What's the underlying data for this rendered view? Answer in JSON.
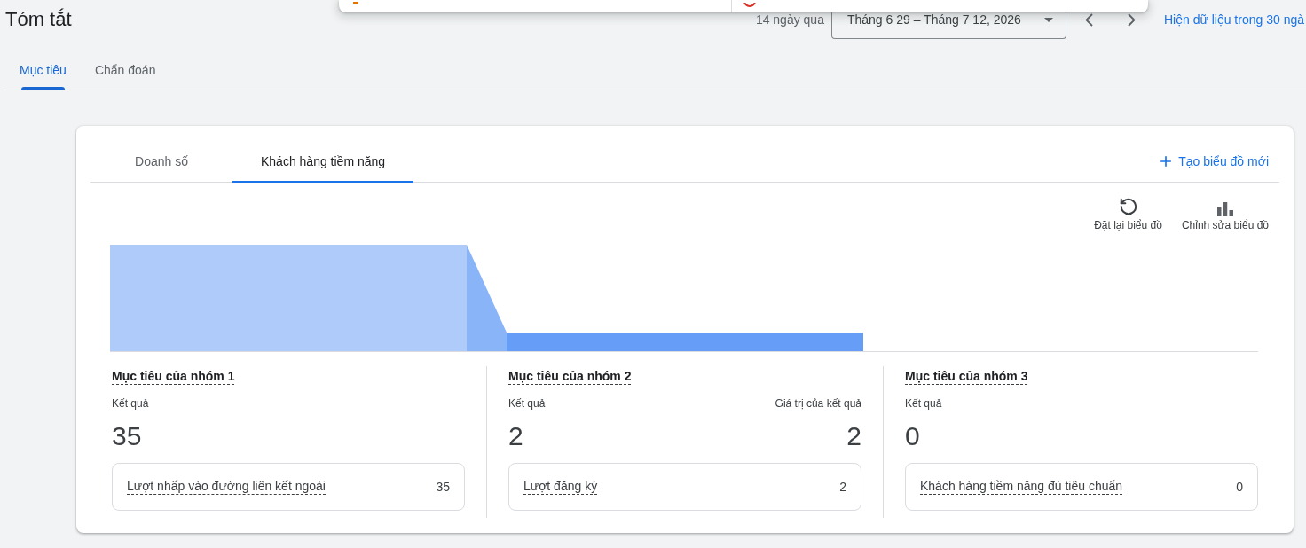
{
  "header": {
    "title": "Tóm tắt",
    "date_preset": "14 ngày qua",
    "date_range": "Tháng 6 29 – Tháng 7 12, 2026",
    "compare_link": "Hiện dữ liệu trong 30 ngà"
  },
  "tabs": [
    {
      "label": "Mục tiêu",
      "selected": true
    },
    {
      "label": "Chẩn đoán",
      "selected": false
    }
  ],
  "card": {
    "tabs": [
      {
        "label": "Doanh số",
        "selected": false
      },
      {
        "label": "Khách hàng tiềm năng",
        "selected": true
      }
    ],
    "create_link": "Tạo biểu đồ mới",
    "toolbar": [
      {
        "kind": "reset",
        "label": "Đặt lại biểu đồ"
      },
      {
        "kind": "edit_chart",
        "label": "Chỉnh sửa biểu đồ"
      }
    ],
    "groups": [
      {
        "title": "Mục tiêu của nhóm 1",
        "metrics": [
          {
            "label": "Kết quả",
            "value": "35"
          }
        ],
        "breakdown": [
          {
            "label": "Lượt nhấp vào đường liên kết ngoài",
            "value": "35"
          }
        ]
      },
      {
        "title": "Mục tiêu của nhóm 2",
        "metrics": [
          {
            "label": "Kết quả",
            "value": "2"
          },
          {
            "label": "Giá trị của kết quả",
            "value": "2"
          }
        ],
        "breakdown": [
          {
            "label": "Lượt đăng ký",
            "value": "2"
          }
        ]
      },
      {
        "title": "Mục tiêu của nhóm 3",
        "metrics": [
          {
            "label": "Kết quả",
            "value": "0"
          }
        ],
        "breakdown": [
          {
            "label": "Khách hàng tiềm năng đủ tiêu chuẩn",
            "value": "0"
          }
        ]
      }
    ]
  }
}
